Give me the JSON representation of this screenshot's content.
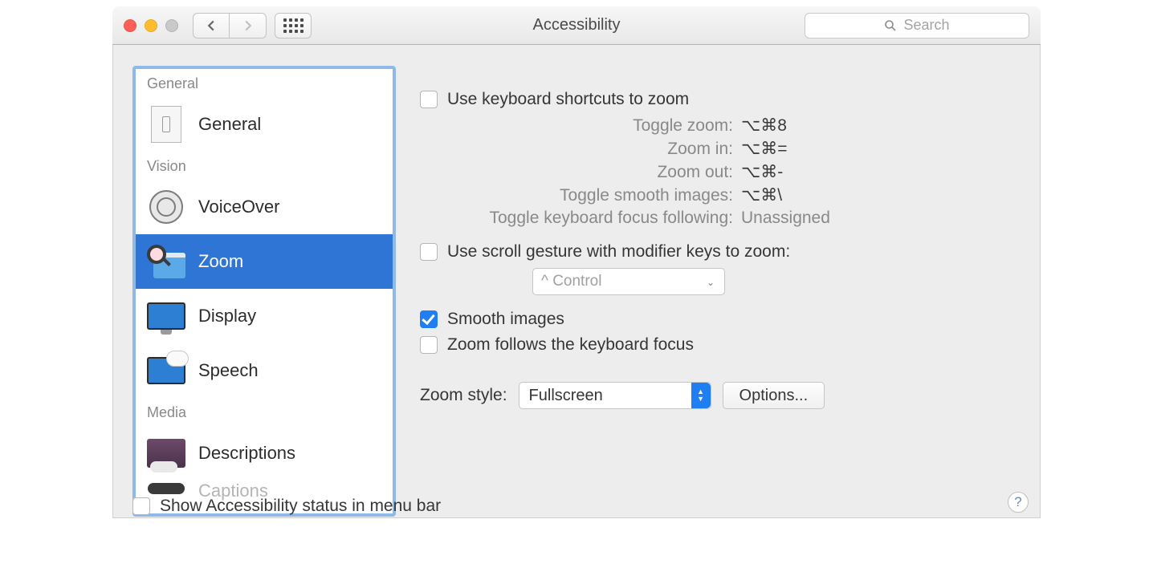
{
  "window": {
    "title": "Accessibility"
  },
  "search": {
    "placeholder": "Search"
  },
  "sidebar": {
    "groups": [
      {
        "label": "General",
        "items": [
          {
            "label": "General"
          }
        ]
      },
      {
        "label": "Vision",
        "items": [
          {
            "label": "VoiceOver"
          },
          {
            "label": "Zoom"
          },
          {
            "label": "Display"
          },
          {
            "label": "Speech"
          }
        ]
      },
      {
        "label": "Media",
        "items": [
          {
            "label": "Descriptions"
          },
          {
            "label": "Captions"
          }
        ]
      }
    ]
  },
  "zoom": {
    "use_keyboard_shortcuts": {
      "label": "Use keyboard shortcuts to zoom",
      "checked": false
    },
    "shortcuts": [
      {
        "label": "Toggle zoom:",
        "value": "⌥⌘8"
      },
      {
        "label": "Zoom in:",
        "value": "⌥⌘="
      },
      {
        "label": "Zoom out:",
        "value": "⌥⌘-"
      },
      {
        "label": "Toggle smooth images:",
        "value": "⌥⌘\\"
      },
      {
        "label": "Toggle keyboard focus following:",
        "value": "Unassigned"
      }
    ],
    "use_scroll_gesture": {
      "label": "Use scroll gesture with modifier keys to zoom:",
      "checked": false
    },
    "modifier_key": {
      "value": "^ Control"
    },
    "smooth_images": {
      "label": "Smooth images",
      "checked": true
    },
    "zoom_follows_focus": {
      "label": "Zoom follows the keyboard focus",
      "checked": false
    },
    "zoom_style": {
      "label": "Zoom style:",
      "value": "Fullscreen"
    },
    "options_button": "Options...",
    "show_status_menubar": {
      "label": "Show Accessibility status in menu bar",
      "checked": false
    },
    "help": "?"
  }
}
